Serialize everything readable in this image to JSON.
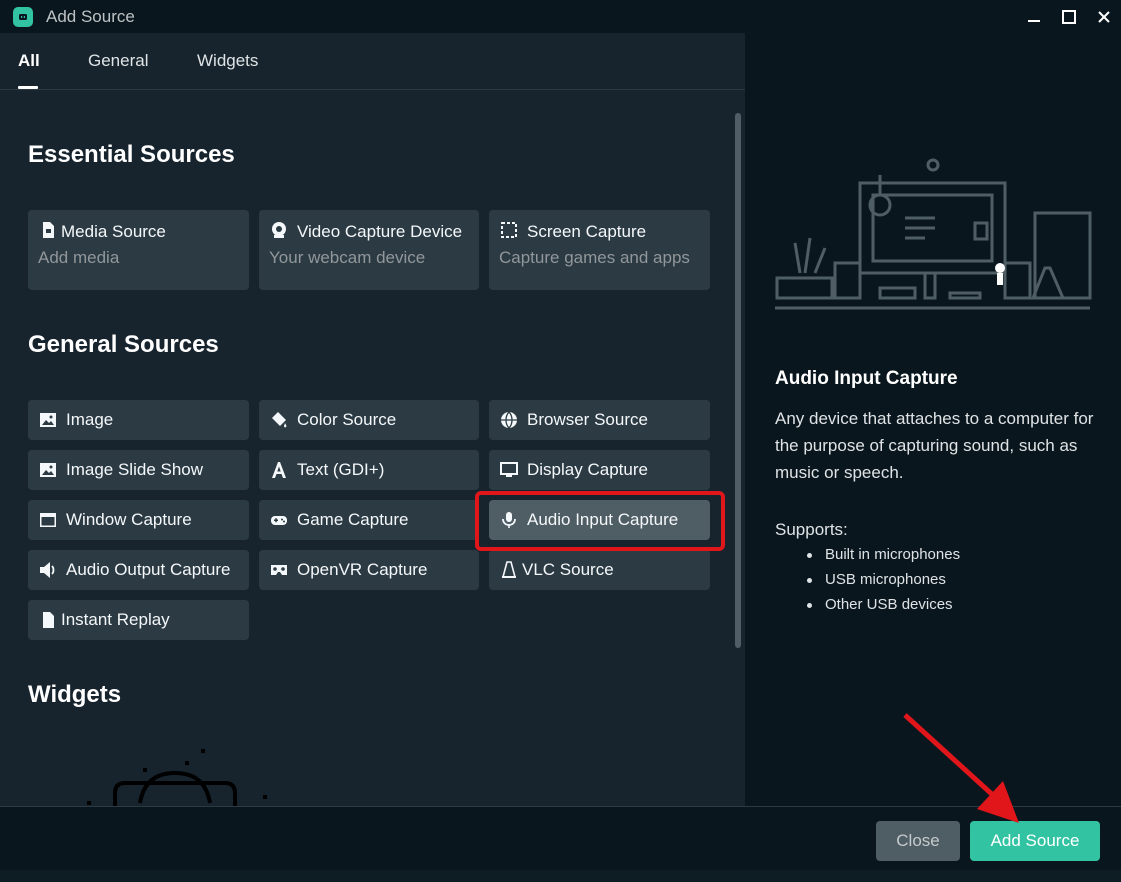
{
  "window": {
    "title": "Add Source"
  },
  "tabs": [
    {
      "label": "All",
      "active": true
    },
    {
      "label": "General",
      "active": false
    },
    {
      "label": "Widgets",
      "active": false
    }
  ],
  "sections": {
    "essential": "Essential Sources",
    "general": "General Sources",
    "widgets": "Widgets"
  },
  "essential_sources": [
    {
      "title": "Media Source",
      "desc": "Add media",
      "icon": "file-icon"
    },
    {
      "title": "Video Capture Device",
      "desc": "Your webcam device",
      "icon": "webcam-icon"
    },
    {
      "title": "Screen Capture",
      "desc": "Capture games and apps",
      "icon": "screen-select-icon"
    }
  ],
  "general_sources": [
    {
      "title": "Image",
      "icon": "image-icon"
    },
    {
      "title": "Color Source",
      "icon": "paint-bucket-icon"
    },
    {
      "title": "Browser Source",
      "icon": "globe-icon"
    },
    {
      "title": "Image Slide Show",
      "icon": "image-icon"
    },
    {
      "title": "Text (GDI+)",
      "icon": "text-icon"
    },
    {
      "title": "Display Capture",
      "icon": "monitor-icon"
    },
    {
      "title": "Window Capture",
      "icon": "window-icon"
    },
    {
      "title": "Game Capture",
      "icon": "gamepad-icon"
    },
    {
      "title": "Audio Input Capture",
      "icon": "microphone-icon",
      "selected": true
    },
    {
      "title": "Audio Output Capture",
      "icon": "speaker-icon"
    },
    {
      "title": "OpenVR Capture",
      "icon": "vr-headset-icon"
    },
    {
      "title": "VLC Source",
      "icon": "vlc-cone-icon"
    },
    {
      "title": "Instant Replay",
      "icon": "file-icon"
    }
  ],
  "details": {
    "title": "Audio Input Capture",
    "description": "Any device that attaches to a computer for the purpose of capturing sound, such as music or speech.",
    "supports_label": "Supports:",
    "supports": [
      "Built in microphones",
      "USB microphones",
      "Other USB devices"
    ]
  },
  "footer": {
    "close_label": "Close",
    "add_label": "Add Source"
  },
  "colors": {
    "accent": "#31c3a2",
    "highlight": "#e0161b",
    "panel": "#17242d",
    "card": "#2b3a43"
  }
}
